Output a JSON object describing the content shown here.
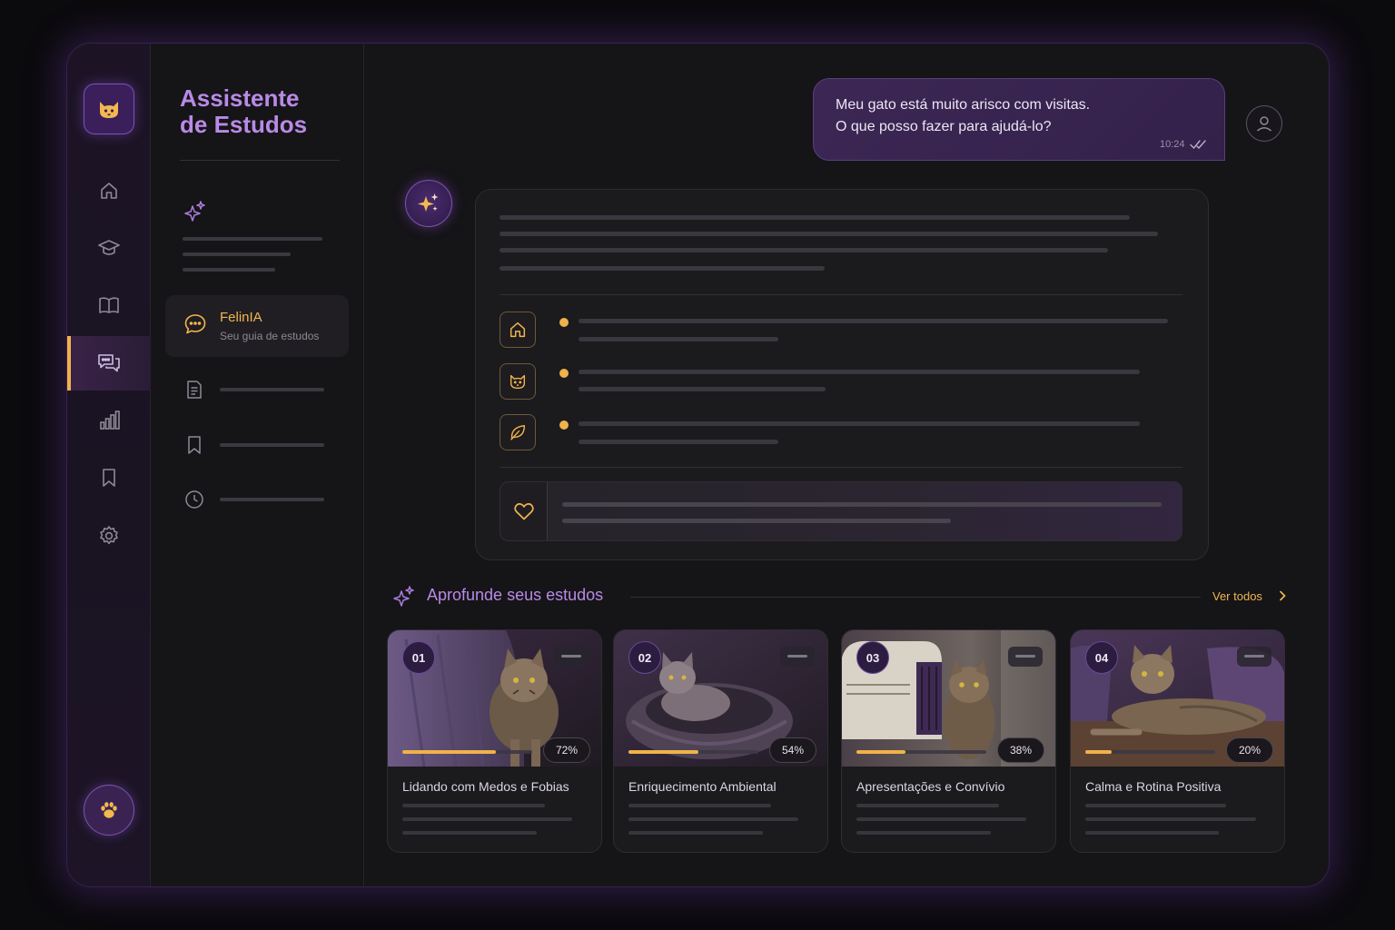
{
  "sidebar": {
    "title_line1": "Assistente",
    "title_line2": "de Estudos",
    "active_chat": {
      "name": "FelinIA",
      "subtitle": "Seu guia de estudos"
    }
  },
  "rail": {
    "items": [
      "home-icon",
      "graduation-cap-icon",
      "book-icon",
      "chat-icon",
      "bar-chart-icon",
      "bookmark-icon",
      "gear-icon"
    ],
    "active": "chat-icon"
  },
  "chat": {
    "user_message_line1": "Meu gato está muito arisco com visitas.",
    "user_message_line2": "O que posso fazer para ajudá-lo?",
    "time": "10:24"
  },
  "studies": {
    "title": "Aprofunde seus estudos",
    "see_all": "Ver todos",
    "cards": [
      {
        "number": "01",
        "progress": "72%",
        "progress_value": 72,
        "title": "Lidando com Medos e Fobias"
      },
      {
        "number": "02",
        "progress": "54%",
        "progress_value": 54,
        "title": "Enriquecimento Ambiental"
      },
      {
        "number": "03",
        "progress": "38%",
        "progress_value": 38,
        "title": "Apresentações e Convívio"
      },
      {
        "number": "04",
        "progress": "20%",
        "progress_value": 20,
        "title": "Calma e Rotina Positiva"
      }
    ]
  },
  "colors": {
    "accent_purple": "#b98ae6",
    "accent_amber": "#f0b24a",
    "background": "#151417"
  }
}
